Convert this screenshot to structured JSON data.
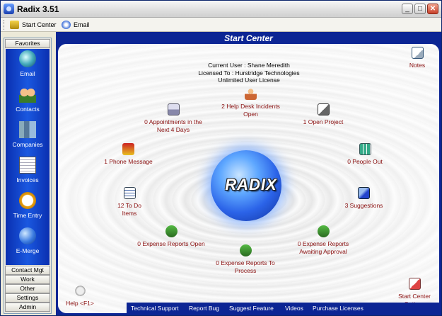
{
  "window": {
    "title": "Radix 3.51"
  },
  "toolbar": {
    "start_center": "Start Center",
    "email": "Email"
  },
  "sidebar": {
    "favorites": "Favorites",
    "items": [
      {
        "label": "Email",
        "icon": "email-icon"
      },
      {
        "label": "Contacts",
        "icon": "contacts-icon"
      },
      {
        "label": "Companies",
        "icon": "companies-icon"
      },
      {
        "label": "Invoices",
        "icon": "invoices-icon"
      },
      {
        "label": "Time Entry",
        "icon": "clock-icon"
      },
      {
        "label": "E-Merge",
        "icon": "globe-icon"
      }
    ],
    "groups": [
      "Contact Mgt",
      "Work",
      "Other",
      "Settings",
      "Admin"
    ]
  },
  "main": {
    "title": "Start Center",
    "current_user": "Current User : Shane Meredith",
    "licensed_to": "Licensed To : Hurstridge Technologies",
    "license": "Unlimited User License",
    "logo": "RADIX",
    "nodes": {
      "notes": "Notes",
      "appointments": "0 Appointments in the Next 4 Days",
      "helpdesk": "2 Help Desk Incidents Open",
      "open_project": "1 Open Project",
      "phone": "1 Phone Message",
      "people_out": "0 People Out",
      "todo": "12 To Do Items",
      "suggestions": "3 Suggestions",
      "expense_open": "0 Expense Reports Open",
      "expense_awaiting": "0 Expense Reports Awaiting Approval",
      "expense_process": "0 Expense Reports To Process",
      "help": "Help <F1>",
      "options": "Start Center Options"
    },
    "footer": [
      "Technical Support",
      "Report Bug",
      "Suggest Feature",
      "Videos",
      "Purchase Licenses"
    ]
  }
}
